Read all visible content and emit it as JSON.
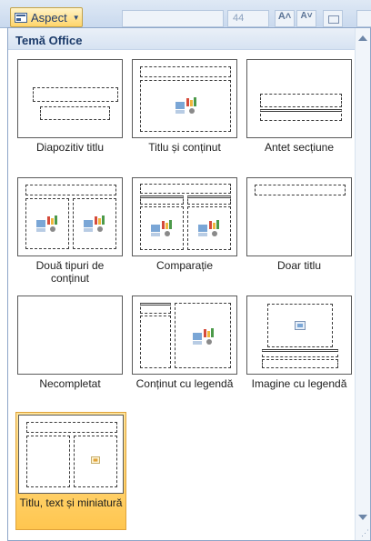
{
  "toolbar": {
    "aspect_label": "Aspect",
    "font_size": "44",
    "grow_font_label": "A˄",
    "shrink_font_label": "A˅"
  },
  "gallery": {
    "header": "Temă Office",
    "layouts": [
      {
        "label": "Diapozitiv titlu"
      },
      {
        "label": "Titlu și conținut"
      },
      {
        "label": "Antet secțiune"
      },
      {
        "label": "Două tipuri de conținut"
      },
      {
        "label": "Comparație"
      },
      {
        "label": "Doar titlu"
      },
      {
        "label": "Necompletat"
      },
      {
        "label": "Conținut cu legendă"
      },
      {
        "label": "Imagine cu legendă"
      },
      {
        "label": "Titlu, text și miniatură"
      }
    ],
    "selected_index": 9
  },
  "colors": {
    "selected_highlight": "#ffc64f",
    "header_text": "#1c3b6a",
    "accent": "#3b5f92"
  }
}
